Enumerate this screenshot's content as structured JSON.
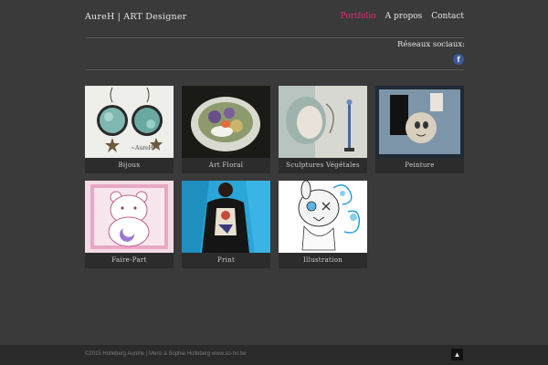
{
  "header": {
    "site_title": "AureH | ART Designer",
    "nav": [
      {
        "label": "Portfolio",
        "active": true
      },
      {
        "label": "A propos",
        "active": false
      },
      {
        "label": "Contact",
        "active": false
      }
    ]
  },
  "social": {
    "label": "Réseaux sociaux:",
    "facebook_glyph": "f",
    "facebook_icon": "facebook-icon"
  },
  "portfolio": {
    "items": [
      {
        "label": "Bijoux",
        "image": "earrings-photo"
      },
      {
        "label": "Art Floral",
        "image": "floral-bowl-photo"
      },
      {
        "label": "Sculptures Végétales",
        "image": "sculpture-photo"
      },
      {
        "label": "Peinture",
        "image": "painting-photo"
      },
      {
        "label": "Faire-Part",
        "image": "bear-card-illustration"
      },
      {
        "label": "Print",
        "image": "printed-tshirt-photo"
      },
      {
        "label": "Illustration",
        "image": "bunny-illustration"
      }
    ]
  },
  "footer": {
    "copyright": "©2015 Holleberg Aurélie | Merci à Sophie Holleberg www.so-ho.be",
    "to_top_glyph": "▲"
  },
  "colors": {
    "background": "#3a3a3a",
    "accent": "#e0287a",
    "facebook": "#3b5998"
  }
}
